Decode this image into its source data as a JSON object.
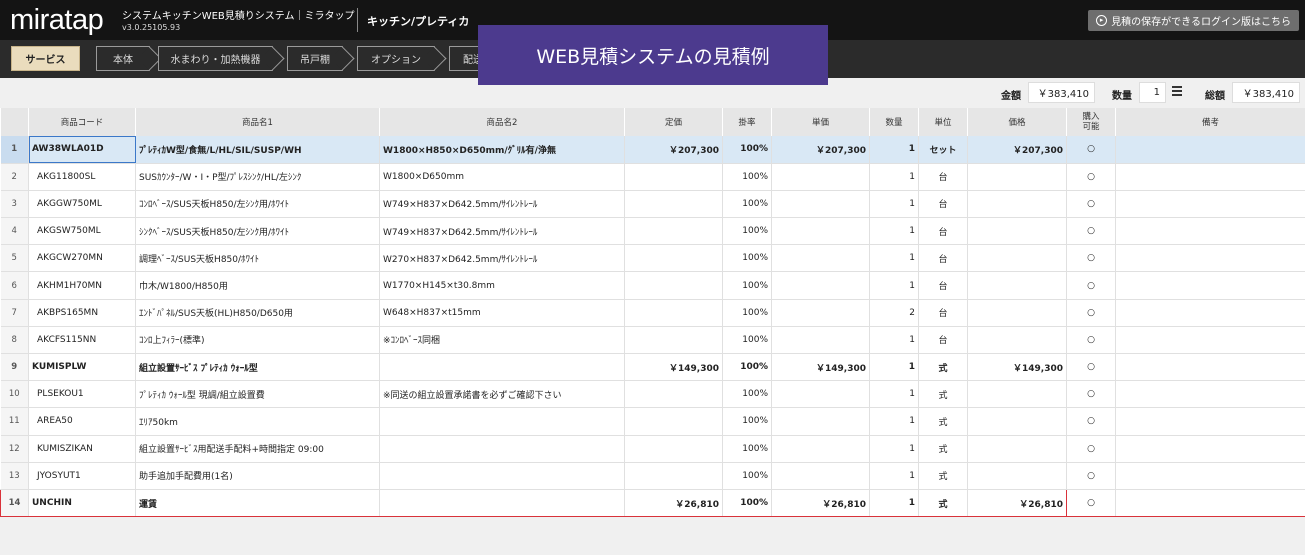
{
  "header": {
    "logo": "miratap",
    "system_title": "システムキッチンWEB見積りシステム｜ミラタップ",
    "version": "v3.0.25105.93",
    "product": "キッチン/プレティカ",
    "login_button": "見積の保存ができるログイン版はこちら"
  },
  "banner": "WEB見積システムの見積例",
  "tabs": [
    "サービス",
    "本体",
    "水まわり・加熱機器",
    "吊戸棚",
    "オプション",
    "配送"
  ],
  "totals": {
    "amount_label": "金額",
    "amount": "￥383,410",
    "qty_label": "数量",
    "qty": "1",
    "total_label": "総額",
    "total": "￥383,410"
  },
  "columns": [
    "",
    "商品コード",
    "商品名1",
    "商品名2",
    "定価",
    "掛率",
    "単価",
    "数量",
    "単位",
    "価格",
    "購入可能",
    "備考"
  ],
  "rows": [
    {
      "no": "1",
      "code": "AW38WLA01D",
      "name1": "ﾌﾟﾚﾃｨｶW型/食無/L/HL/SIL/SUSP/WH",
      "name2": "W1800×H850×D650mm/ｸﾞﾘﾙ有/浄無",
      "list": "￥207,300",
      "rate": "100%",
      "unit_price": "￥207,300",
      "qty": "1",
      "unit": "セット",
      "price": "￥207,300",
      "buy": "○",
      "note": ""
    },
    {
      "no": "2",
      "code": "AKG11800SL",
      "name1": "SUSｶｳﾝﾀｰ/W・I・P型/ﾌﾟﾚｽｼﾝｸ/HL/左ｼﾝｸ",
      "name2": "W1800×D650mm",
      "list": "",
      "rate": "100%",
      "unit_price": "",
      "qty": "1",
      "unit": "台",
      "price": "",
      "buy": "○",
      "note": ""
    },
    {
      "no": "3",
      "code": "AKGGW750ML",
      "name1": "ｺﾝﾛﾍﾞｰｽ/SUS天板H850/左ｼﾝｸ用/ﾎﾜｲﾄ",
      "name2": "W749×H837×D642.5mm/ｻｲﾚﾝﾄﾚｰﾙ",
      "list": "",
      "rate": "100%",
      "unit_price": "",
      "qty": "1",
      "unit": "台",
      "price": "",
      "buy": "○",
      "note": ""
    },
    {
      "no": "4",
      "code": "AKGSW750ML",
      "name1": "ｼﾝｸﾍﾞｰｽ/SUS天板H850/左ｼﾝｸ用/ﾎﾜｲﾄ",
      "name2": "W749×H837×D642.5mm/ｻｲﾚﾝﾄﾚｰﾙ",
      "list": "",
      "rate": "100%",
      "unit_price": "",
      "qty": "1",
      "unit": "台",
      "price": "",
      "buy": "○",
      "note": ""
    },
    {
      "no": "5",
      "code": "AKGCW270MN",
      "name1": "調理ﾍﾞｰｽ/SUS天板H850/ﾎﾜｲﾄ",
      "name2": "W270×H837×D642.5mm/ｻｲﾚﾝﾄﾚｰﾙ",
      "list": "",
      "rate": "100%",
      "unit_price": "",
      "qty": "1",
      "unit": "台",
      "price": "",
      "buy": "○",
      "note": ""
    },
    {
      "no": "6",
      "code": "AKHM1H70MN",
      "name1": "巾木/W1800/H850用",
      "name2": "W1770×H145×t30.8mm",
      "list": "",
      "rate": "100%",
      "unit_price": "",
      "qty": "1",
      "unit": "台",
      "price": "",
      "buy": "○",
      "note": ""
    },
    {
      "no": "7",
      "code": "AKBPS165MN",
      "name1": "ｴﾝﾄﾞﾊﾟﾈﾙ/SUS天板(HL)H850/D650用",
      "name2": "W648×H837×t15mm",
      "list": "",
      "rate": "100%",
      "unit_price": "",
      "qty": "2",
      "unit": "台",
      "price": "",
      "buy": "○",
      "note": ""
    },
    {
      "no": "8",
      "code": "AKCFS115NN",
      "name1": "ｺﾝﾛ上ﾌｨﾗｰ(標準)",
      "name2": "※ｺﾝﾛﾍﾞｰｽ同梱",
      "list": "",
      "rate": "100%",
      "unit_price": "",
      "qty": "1",
      "unit": "台",
      "price": "",
      "buy": "○",
      "note": ""
    },
    {
      "no": "9",
      "code": "KUMISPLW",
      "name1": "組立設置ｻｰﾋﾞｽ ﾌﾟﾚﾃｨｶ ｳｫｰﾙ型",
      "name2": "",
      "list": "￥149,300",
      "rate": "100%",
      "unit_price": "￥149,300",
      "qty": "1",
      "unit": "式",
      "price": "￥149,300",
      "buy": "○",
      "note": ""
    },
    {
      "no": "10",
      "code": "PLSEKOU1",
      "name1": "ﾌﾟﾚﾃｨｶ ｳｫｰﾙ型 現調/組立設置費",
      "name2": "※同送の組立設置承諾書を必ずご確認下さい",
      "list": "",
      "rate": "100%",
      "unit_price": "",
      "qty": "1",
      "unit": "式",
      "price": "",
      "buy": "○",
      "note": ""
    },
    {
      "no": "11",
      "code": "AREA50",
      "name1": "ｴﾘｱ50km",
      "name2": "",
      "list": "",
      "rate": "100%",
      "unit_price": "",
      "qty": "1",
      "unit": "式",
      "price": "",
      "buy": "○",
      "note": ""
    },
    {
      "no": "12",
      "code": "KUMISZIKAN",
      "name1": "組立設置ｻｰﾋﾞｽ用配送手配料+時間指定 09:00",
      "name2": "",
      "list": "",
      "rate": "100%",
      "unit_price": "",
      "qty": "1",
      "unit": "式",
      "price": "",
      "buy": "○",
      "note": ""
    },
    {
      "no": "13",
      "code": "JYOSYUT1",
      "name1": "助手追加手配費用(1名)",
      "name2": "",
      "list": "",
      "rate": "100%",
      "unit_price": "",
      "qty": "1",
      "unit": "式",
      "price": "",
      "buy": "○",
      "note": ""
    },
    {
      "no": "14",
      "code": "UNCHIN",
      "name1": "運賃",
      "name2": "",
      "list": "￥26,810",
      "rate": "100%",
      "unit_price": "￥26,810",
      "qty": "1",
      "unit": "式",
      "price": "￥26,810",
      "buy": "○",
      "note": ""
    }
  ]
}
